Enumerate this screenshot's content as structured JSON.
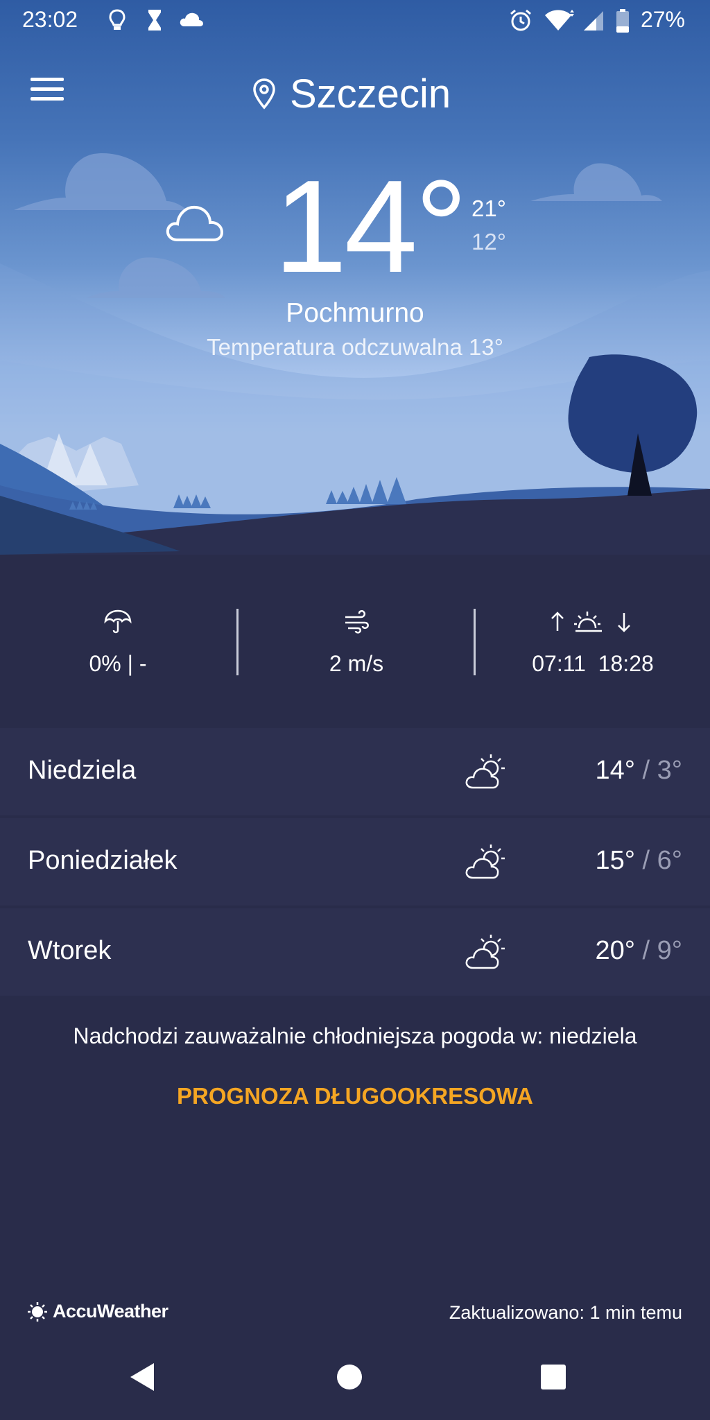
{
  "status_bar": {
    "time": "23:02",
    "battery": "27%"
  },
  "header": {
    "location": "Szczecin"
  },
  "current": {
    "temp": "14°",
    "high": "21°",
    "low": "12°",
    "condition": "Pochmurno",
    "feels_like": "Temperatura odczuwalna 13°",
    "icon": "cloud-icon"
  },
  "stats": {
    "precip": "0% | -",
    "wind": "2 m/s",
    "sunrise": "07:11",
    "sunset": "18:28"
  },
  "forecast": [
    {
      "day": "Niedziela",
      "high": "14°",
      "low": "3°",
      "icon": "partly-sunny-icon"
    },
    {
      "day": "Poniedziałek",
      "high": "15°",
      "low": "6°",
      "icon": "partly-sunny-icon"
    },
    {
      "day": "Wtorek",
      "high": "20°",
      "low": "9°",
      "icon": "partly-sunny-icon"
    }
  ],
  "notice": "Nadchodzi zauważalnie chłodniejsza pogoda w: niedziela",
  "long_term_label": "PROGNOZA DŁUGOOKRESOWA",
  "footer": {
    "brand": "AccuWeather",
    "updated": "Zaktualizowano: 1 min temu"
  },
  "colors": {
    "background": "#292c4a",
    "accent": "#f5a623",
    "row_alt": "#2d3050"
  }
}
